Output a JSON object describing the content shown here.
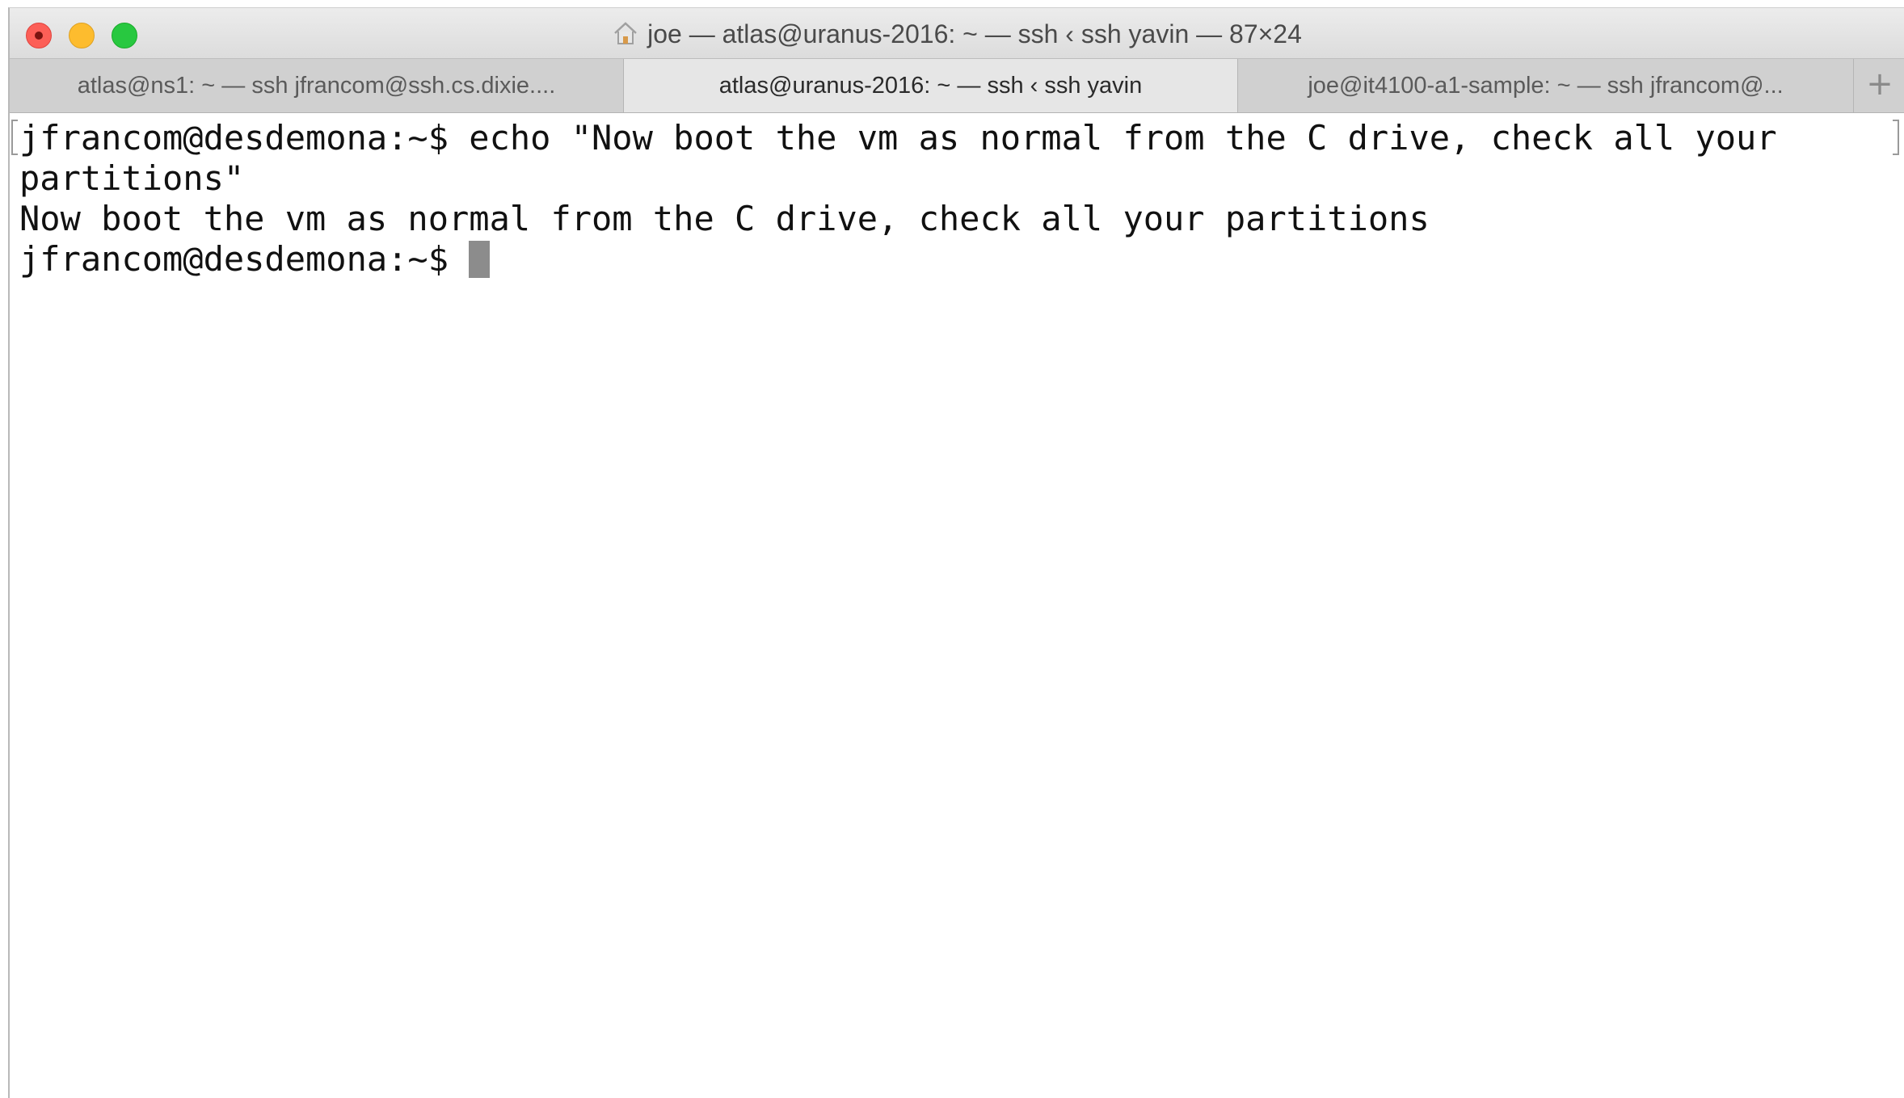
{
  "window": {
    "title": "joe — atlas@uranus-2016: ~ — ssh ‹ ssh yavin — 87×24",
    "colors": {
      "close": "#fc5f57",
      "minimize": "#fdbc2e",
      "zoom": "#28c840",
      "active_tab": "#e6e6e6",
      "inactive_tab": "#d0d0d0",
      "cursor": "#8c8c8c"
    }
  },
  "tabs": [
    {
      "label": "atlas@ns1: ~ — ssh jfrancom@ssh.cs.dixie...."
    },
    {
      "label": "atlas@uranus-2016: ~ — ssh ‹ ssh yavin"
    },
    {
      "label": "joe@it4100-a1-sample: ~ — ssh jfrancom@..."
    }
  ],
  "tab_add_label": "+",
  "terminal": {
    "lines": [
      "jfrancom@desdemona:~$ echo \"Now boot the vm as normal from the C drive, check all your",
      "partitions\"",
      "Now boot the vm as normal from the C drive, check all your partitions"
    ],
    "prompt": "jfrancom@desdemona:~$ "
  }
}
